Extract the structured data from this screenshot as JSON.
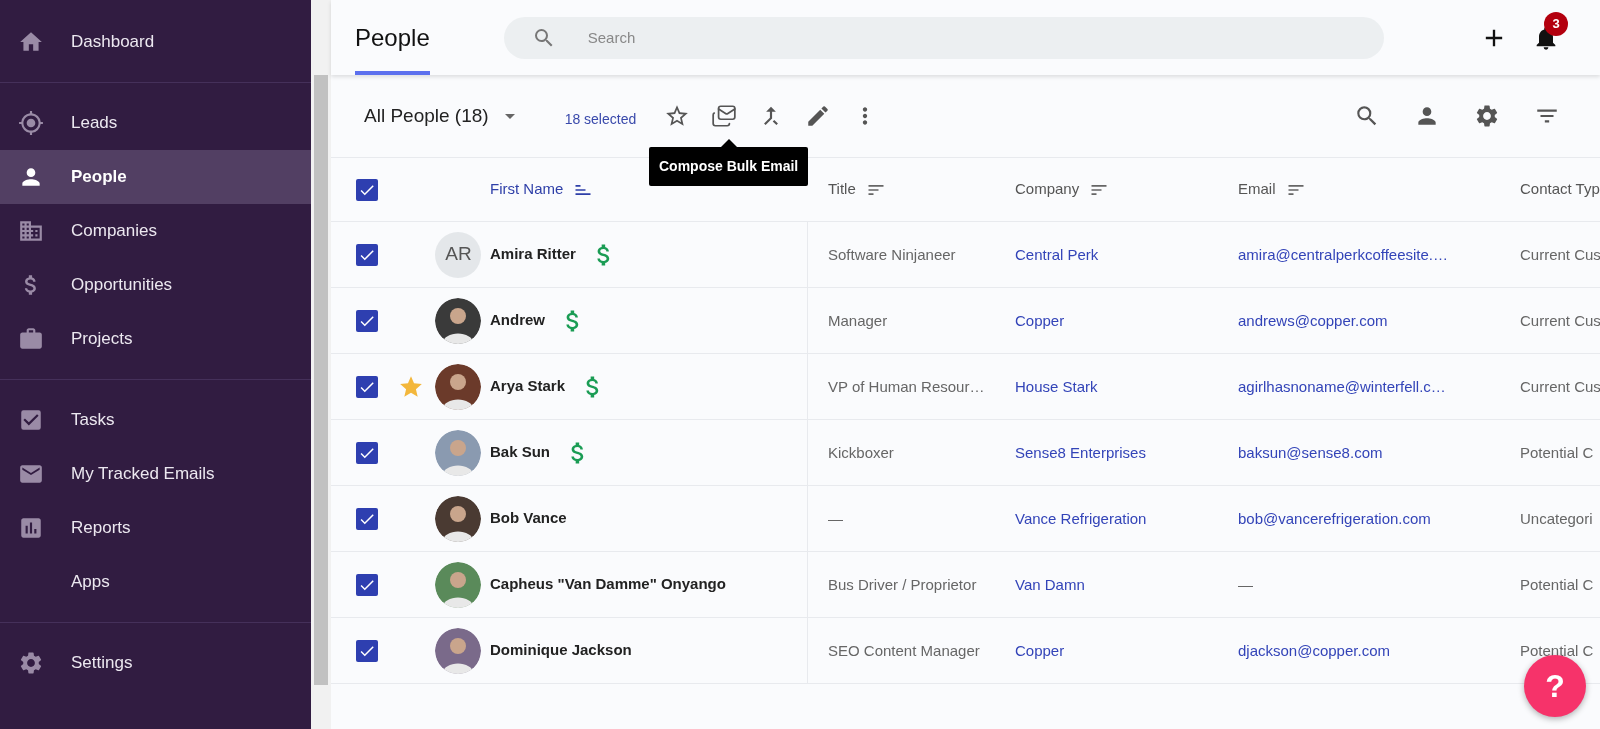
{
  "sidebar": {
    "groups": [
      [
        {
          "label": "Dashboard",
          "selected": false
        }
      ],
      [
        {
          "label": "Leads",
          "selected": false
        },
        {
          "label": "People",
          "selected": true
        },
        {
          "label": "Companies",
          "selected": false
        },
        {
          "label": "Opportunities",
          "selected": false
        },
        {
          "label": "Projects",
          "selected": false
        }
      ],
      [
        {
          "label": "Tasks",
          "selected": false
        },
        {
          "label": "My Tracked Emails",
          "selected": false
        },
        {
          "label": "Reports",
          "selected": false
        },
        {
          "label": "Apps",
          "selected": false
        }
      ],
      [
        {
          "label": "Settings",
          "selected": false
        }
      ]
    ]
  },
  "header": {
    "tab": {
      "label": "People",
      "selected": true
    },
    "search": {
      "placeholder": "Search"
    },
    "notifications": {
      "count": "3"
    }
  },
  "toolbar": {
    "view": "All People (18)",
    "selection": "18 selected",
    "tooltip": "Compose Bulk Email"
  },
  "table": {
    "all_checked": true,
    "columns": [
      {
        "label": "First Name",
        "sorted": true
      },
      {
        "label": "Title",
        "sorted": false
      },
      {
        "label": "Company",
        "sorted": false
      },
      {
        "label": "Email",
        "sorted": false
      },
      {
        "label": "Contact Typ",
        "sorted": false
      }
    ],
    "rows": [
      {
        "checked": true,
        "starred": false,
        "avatar": {
          "kind": "initials",
          "text": "AR"
        },
        "name": "Amira Ritter",
        "opportunity": true,
        "title": "Software Ninjaneer",
        "company": "Central Perk",
        "email": "amira@centralperkcoffeesite.…",
        "email_empty": false,
        "contact_type": "Current Cus"
      },
      {
        "checked": true,
        "starred": false,
        "name": "Andrew",
        "opportunity": true,
        "title": "Manager",
        "company": "Copper",
        "email": "andrews@copper.com",
        "email_empty": false,
        "contact_type": "Current Cus"
      },
      {
        "checked": true,
        "starred": true,
        "name": "Arya Stark",
        "opportunity": true,
        "title": "VP of Human Resour…",
        "company": "House Stark",
        "email": "agirlhasnoname@winterfell.c…",
        "email_empty": false,
        "contact_type": "Current Cus"
      },
      {
        "checked": true,
        "starred": false,
        "name": "Bak Sun",
        "opportunity": true,
        "title": "Kickboxer",
        "company": "Sense8 Enterprises",
        "email": "baksun@sense8.com",
        "email_empty": false,
        "contact_type": "Potential C"
      },
      {
        "checked": true,
        "starred": false,
        "name": "Bob Vance",
        "opportunity": false,
        "title": "—",
        "company": "Vance Refrigeration",
        "email": "bob@vancerefrigeration.com",
        "email_empty": false,
        "contact_type": "Uncategori"
      },
      {
        "checked": true,
        "starred": false,
        "name": "Capheus \"Van Damme\" Onyango",
        "opportunity": false,
        "title": "Bus Driver / Proprietor",
        "company": "Van Damn",
        "email": "—",
        "email_empty": true,
        "contact_type": "Potential C"
      },
      {
        "checked": true,
        "starred": false,
        "name": "Dominique Jackson",
        "opportunity": false,
        "title": "SEO Content Manager",
        "company": "Copper",
        "email": "djackson@copper.com",
        "email_empty": false,
        "contact_type": "Potential C"
      }
    ]
  },
  "help": {
    "label": "?"
  }
}
